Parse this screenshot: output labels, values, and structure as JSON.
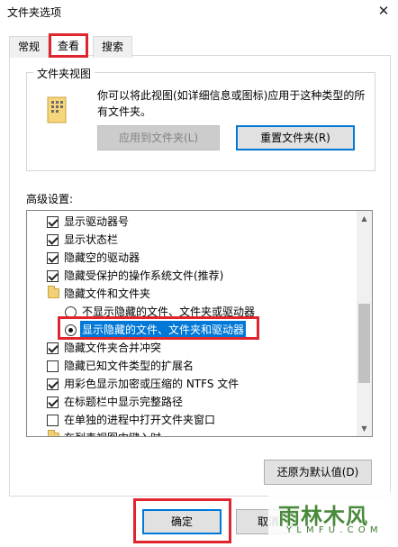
{
  "dialog": {
    "title": "文件夹选项"
  },
  "tabs": [
    {
      "label": "常规"
    },
    {
      "label": "查看"
    },
    {
      "label": "搜索"
    }
  ],
  "folder_views": {
    "group_label": "文件夹视图",
    "description": "你可以将此视图(如详细信息或图标)应用于这种类型的所有文件夹。",
    "apply_button": "应用到文件夹(L)",
    "reset_button": "重置文件夹(R)"
  },
  "advanced": {
    "label": "高级设置:",
    "items": [
      {
        "type": "checkbox",
        "checked": true,
        "label": "显示驱动器号"
      },
      {
        "type": "checkbox",
        "checked": true,
        "label": "显示状态栏"
      },
      {
        "type": "checkbox",
        "checked": true,
        "label": "隐藏空的驱动器"
      },
      {
        "type": "checkbox",
        "checked": true,
        "label": "隐藏受保护的操作系统文件(推荐)"
      },
      {
        "type": "folder",
        "label": "隐藏文件和文件夹"
      },
      {
        "type": "radio",
        "checked": false,
        "label": "不显示隐藏的文件、文件夹或驱动器"
      },
      {
        "type": "radio",
        "checked": true,
        "label": "显示隐藏的文件、文件夹和驱动器"
      },
      {
        "type": "checkbox",
        "checked": true,
        "label": "隐藏文件夹合并冲突"
      },
      {
        "type": "checkbox",
        "checked": false,
        "label": "隐藏已知文件类型的扩展名"
      },
      {
        "type": "checkbox",
        "checked": true,
        "label": "用彩色显示加密或压缩的 NTFS 文件"
      },
      {
        "type": "checkbox",
        "checked": true,
        "label": "在标题栏中显示完整路径"
      },
      {
        "type": "checkbox",
        "checked": false,
        "label": "在单独的进程中打开文件夹窗口"
      },
      {
        "type": "folder",
        "label": "在列表视图中键入时"
      }
    ],
    "restore_button": "还原为默认值(D)"
  },
  "footer": {
    "ok_button": "确定",
    "cancel_button": "取消"
  },
  "watermark": {
    "main": "雨林木风",
    "sub": "Y L M F U . C O M"
  },
  "colors": {
    "highlight": "#e0252f",
    "accent": "#0078d7"
  }
}
